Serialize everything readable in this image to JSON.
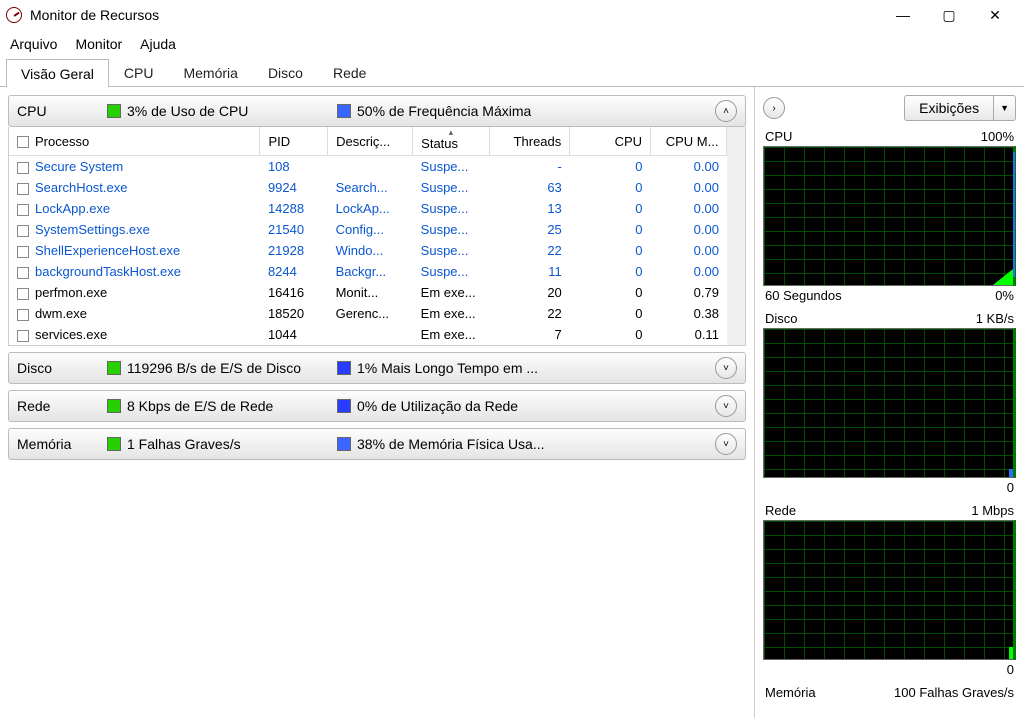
{
  "window": {
    "title": "Monitor de Recursos"
  },
  "menus": {
    "file": "Arquivo",
    "monitor": "Monitor",
    "help": "Ajuda"
  },
  "tabs": {
    "overview": "Visão Geral",
    "cpu": "CPU",
    "memory": "Memória",
    "disk": "Disco",
    "network": "Rede"
  },
  "sections": {
    "cpu": {
      "label": "CPU",
      "stat1": "3% de Uso de CPU",
      "stat2": "50% de Frequência Máxima",
      "color1": "#27d100",
      "color2": "#3b65ff"
    },
    "disk": {
      "label": "Disco",
      "stat1": "119296 B/s de E/S de Disco",
      "stat2": "1% Mais Longo Tempo em ...",
      "color1": "#27d100",
      "color2": "#2a3cff"
    },
    "network": {
      "label": "Rede",
      "stat1": "8 Kbps de E/S de Rede",
      "stat2": "0% de Utilização da Rede",
      "color1": "#27d100",
      "color2": "#2a3cff"
    },
    "memory": {
      "label": "Memória",
      "stat1": "1 Falhas Graves/s",
      "stat2": "38% de Memória Física Usa...",
      "color1": "#27d100",
      "color2": "#3b65ff"
    }
  },
  "columns": {
    "process": "Processo",
    "pid": "PID",
    "desc": "Descriç...",
    "status": "Status",
    "threads": "Threads",
    "cpu": "CPU",
    "cpumem": "CPU M..."
  },
  "rows": [
    {
      "name": "Secure System",
      "pid": "108",
      "desc": "",
      "status": "Suspe...",
      "threads": "-",
      "cpu": "0",
      "mem": "0.00",
      "susp": true
    },
    {
      "name": "SearchHost.exe",
      "pid": "9924",
      "desc": "Search...",
      "status": "Suspe...",
      "threads": "63",
      "cpu": "0",
      "mem": "0.00",
      "susp": true
    },
    {
      "name": "LockApp.exe",
      "pid": "14288",
      "desc": "LockAp...",
      "status": "Suspe...",
      "threads": "13",
      "cpu": "0",
      "mem": "0.00",
      "susp": true
    },
    {
      "name": "SystemSettings.exe",
      "pid": "21540",
      "desc": "Config...",
      "status": "Suspe...",
      "threads": "25",
      "cpu": "0",
      "mem": "0.00",
      "susp": true
    },
    {
      "name": "ShellExperienceHost.exe",
      "pid": "21928",
      "desc": "Windo...",
      "status": "Suspe...",
      "threads": "22",
      "cpu": "0",
      "mem": "0.00",
      "susp": true
    },
    {
      "name": "backgroundTaskHost.exe",
      "pid": "8244",
      "desc": "Backgr...",
      "status": "Suspe...",
      "threads": "11",
      "cpu": "0",
      "mem": "0.00",
      "susp": true
    },
    {
      "name": "perfmon.exe",
      "pid": "16416",
      "desc": "Monit...",
      "status": "Em exe...",
      "threads": "20",
      "cpu": "0",
      "mem": "0.79",
      "susp": false
    },
    {
      "name": "dwm.exe",
      "pid": "18520",
      "desc": "Gerenc...",
      "status": "Em exe...",
      "threads": "22",
      "cpu": "0",
      "mem": "0.38",
      "susp": false
    },
    {
      "name": "services.exe",
      "pid": "1044",
      "desc": "",
      "status": "Em exe...",
      "threads": "7",
      "cpu": "0",
      "mem": "0.11",
      "susp": false
    }
  ],
  "views_button": "Exibições",
  "charts": {
    "cpu": {
      "title": "CPU",
      "top": "100%",
      "bl": "60 Segundos",
      "br": "0%"
    },
    "disk": {
      "title": "Disco",
      "top": "1 KB/s",
      "bl": "",
      "br": "0"
    },
    "net": {
      "title": "Rede",
      "top": "1 Mbps",
      "bl": "",
      "br": "0"
    },
    "mem": {
      "title": "Memória",
      "top": "100 Falhas Graves/s"
    }
  }
}
